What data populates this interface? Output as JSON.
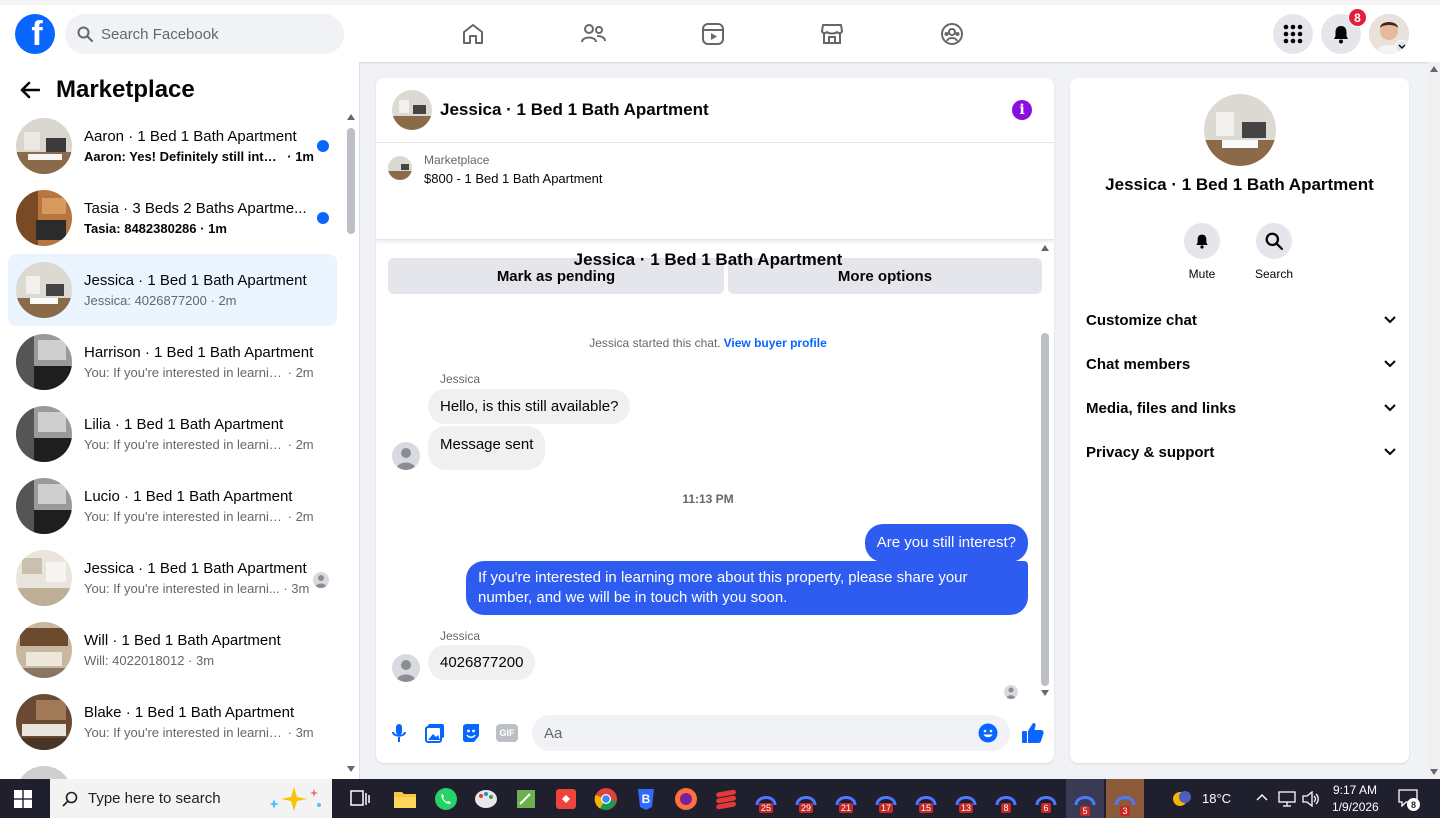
{
  "nav": {
    "logo_letter": "f",
    "search_placeholder": "Search Facebook",
    "notification_count": "8"
  },
  "sidebar": {
    "title": "Marketplace",
    "conversations": [
      {
        "name": "Aaron · 1 Bed 1 Bath Apartment",
        "snippet": "Aaron: Yes! Definitely still inter...",
        "time": "· 1m",
        "unread": true
      },
      {
        "name": "Tasia · 3 Beds 2 Baths Apartme...",
        "snippet": "Tasia: 8482380286",
        "time": "· 1m",
        "unread": true
      },
      {
        "name": "Jessica · 1 Bed 1 Bath Apartment",
        "snippet": "Jessica: 4026877200",
        "time": "· 2m",
        "active": true
      },
      {
        "name": "Harrison · 1 Bed 1 Bath Apartment",
        "snippet": "You: If you're interested in learning...",
        "time": "· 2m"
      },
      {
        "name": "Lilia · 1 Bed 1 Bath Apartment",
        "snippet": "You: If you're interested in learning...",
        "time": "· 2m"
      },
      {
        "name": "Lucio · 1 Bed 1 Bath Apartment",
        "snippet": "You: If you're interested in learning...",
        "time": "· 2m"
      },
      {
        "name": "Jessica · 1 Bed 1 Bath Apartment",
        "snippet": "You: If you're interested in learni...",
        "time": "· 3m"
      },
      {
        "name": "Will · 1 Bed 1 Bath Apartment",
        "snippet": "Will: 4022018012",
        "time": "· 3m"
      },
      {
        "name": "Blake · 1 Bed 1 Bath Apartment",
        "snippet": "You: If you're interested in learning...",
        "time": "· 3m"
      }
    ]
  },
  "chat": {
    "header_name": "Jessica · 1 Bed 1 Bath Apartment",
    "marketplace_label": "Marketplace",
    "listing": "$800 - 1 Bed 1 Bath Apartment",
    "mark_pending_label": "Mark as pending",
    "more_options_label": "More options",
    "center_title": "Jessica · 1 Bed 1 Bath Apartment",
    "started_text": "Jessica started this chat.",
    "view_profile_label": "View buyer profile",
    "sender_name": "Jessica",
    "msg_in_1": "Hello, is this still available?",
    "msg_in_2": "Message sent",
    "timestamp": "11:13 PM",
    "msg_out_1": "Are you still interest?",
    "msg_out_2": "If you're interested in learning more about this property, please share your number, and we will be in touch with you soon.",
    "sender_name_2": "Jessica",
    "msg_in_3": "4026877200",
    "composer_placeholder": "Aa",
    "gif_label": "GIF"
  },
  "details": {
    "name": "Jessica · 1 Bed 1 Bath Apartment",
    "mute_label": "Mute",
    "search_label": "Search",
    "sections": [
      "Customize chat",
      "Chat members",
      "Media, files and links",
      "Privacy & support"
    ]
  },
  "taskbar": {
    "search_placeholder": "Type here to search",
    "weather": "18°C",
    "time": "9:17 AM",
    "date": "1/9/2026",
    "notif_count": "8",
    "app_badges": [
      "25",
      "29",
      "21",
      "17",
      "15",
      "13",
      "8",
      "6",
      "5",
      "3"
    ]
  },
  "colors": {
    "brand": "#0866ff",
    "outgoing_bubble": "#2e5bf0",
    "info": "#8a0ee0",
    "unread_dot": "#0866ff"
  }
}
